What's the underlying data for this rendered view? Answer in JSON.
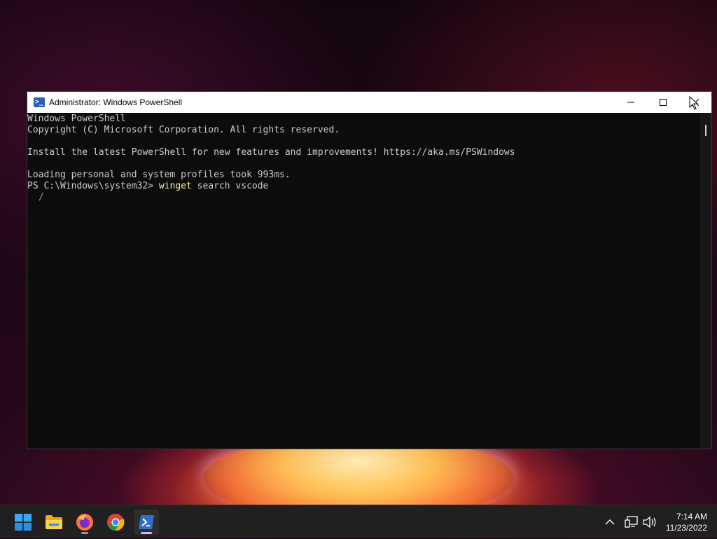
{
  "window": {
    "title": "Administrator: Windows PowerShell",
    "app_icon_glyph": ">_"
  },
  "console": {
    "lines": [
      "Windows PowerShell",
      "Copyright (C) Microsoft Corporation. All rights reserved.",
      "",
      "Install the latest PowerShell for new features and improvements! https://aka.ms/PSWindows",
      "",
      "Loading personal and system profiles took 993ms."
    ],
    "prompt": "PS C:\\Windows\\system32> ",
    "command": "winget",
    "command_args": " search vscode",
    "spinner": "/"
  },
  "taskbar": {
    "apps": [
      {
        "name": "start-button",
        "icon": "windows-logo-icon"
      },
      {
        "name": "file-explorer",
        "icon": "folder-icon"
      },
      {
        "name": "firefox",
        "icon": "firefox-icon"
      },
      {
        "name": "chrome",
        "icon": "chrome-icon"
      },
      {
        "name": "powershell",
        "icon": "powershell-icon"
      }
    ],
    "clock": {
      "time": "7:14 AM",
      "date": "11/23/2022"
    }
  },
  "colors": {
    "console_bg": "#0c0c0c",
    "console_fg": "#cccccc",
    "command_color": "#f9f1a5",
    "titlebar_bg": "#ffffff",
    "taskbar_bg": "#202020",
    "accent_active": "#d9b3e6"
  }
}
